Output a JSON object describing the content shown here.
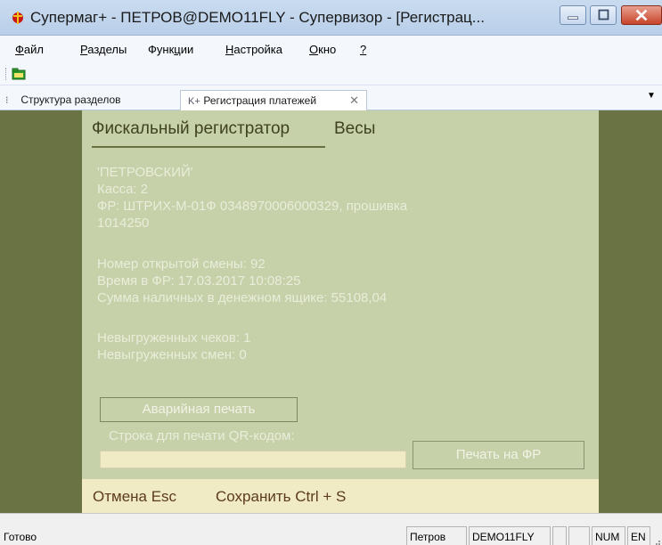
{
  "window": {
    "title": "Супермаг+ - ПЕТРОВ@DEMO11FLY - Супервизор  - [Регистрац..."
  },
  "menu": {
    "items": [
      {
        "underline": "Ф",
        "rest": "айл"
      },
      {
        "underline": "Р",
        "rest": "азделы"
      },
      {
        "pre": "Функ",
        "underline": "ц",
        "rest": "ии"
      },
      {
        "underline": "Н",
        "rest": "астройка"
      },
      {
        "underline": "О",
        "rest": "кно"
      },
      {
        "underline": "?",
        "rest": ""
      }
    ]
  },
  "tabs": [
    {
      "label": "Структура разделов",
      "icon": "tree-icon"
    },
    {
      "label": "Регистрация платежей",
      "icon": "K+"
    }
  ],
  "panel": {
    "tabs": [
      "Фискальный регистратор",
      "Весы"
    ],
    "info": {
      "store": "'ПЕТРОВСКИЙ'",
      "kassa": "Касса: 2",
      "fr_line1": "ФР: ШТРИХ-М-01Ф 0348970006000329, прошивка",
      "fr_line2": "1014250",
      "shift": "Номер открытой смены: 92",
      "time": "Время в ФР: 17.03.2017 10:08:25",
      "cash": "Сумма наличных в денежном ящике: 55108,04",
      "unsent_checks": "Невыгруженных чеков: 1",
      "unsent_shifts": "Невыгруженных смен: 0"
    },
    "emergency_print_label": "Аварийная печать",
    "qr_label": "Строка для печати QR-кодом:",
    "qr_value": "",
    "print_fr_label": "Печать на ФР",
    "cancel_label": "Отмена Esc",
    "save_label": "Сохранить Ctrl + S"
  },
  "status": {
    "ready": "Готово",
    "user": "Петров",
    "db": "DEMO11FLY",
    "empty1": "",
    "empty2": "",
    "num": "NUM",
    "lang": "EN"
  },
  "colors": {
    "client_bg": "#6a7344",
    "panel_bg": "#c6d0a9",
    "bottom_bar_bg": "#f0ebc4",
    "action_text": "#5c3b1c"
  }
}
